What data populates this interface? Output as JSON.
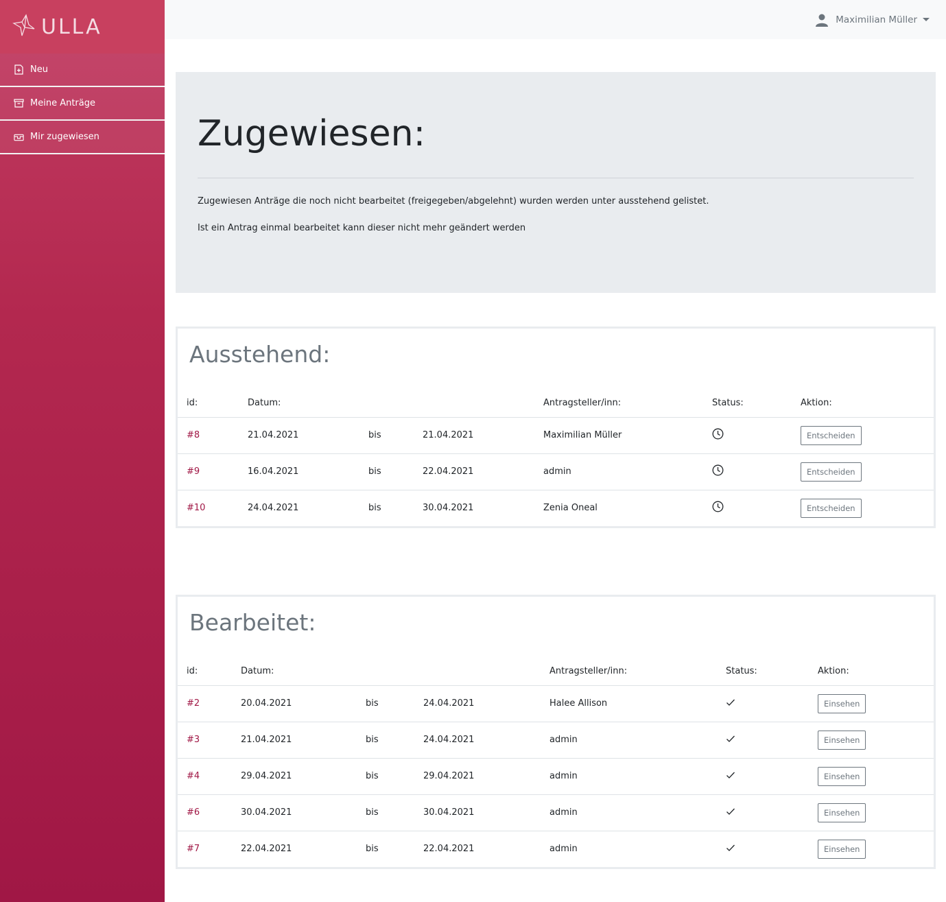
{
  "brand": {
    "name": "ULLA"
  },
  "sidebar": {
    "items": [
      {
        "label": "Neu",
        "icon": "file-plus-icon"
      },
      {
        "label": "Meine Anträge",
        "icon": "archive-icon"
      },
      {
        "label": "Mir zugewiesen",
        "icon": "inbox-icon"
      }
    ]
  },
  "header": {
    "user_name": "Maximilian Müller"
  },
  "jumbotron": {
    "title": "Zugewiesen:",
    "text1": "Zugewiesen Anträge die noch nicht bearbeitet (freigegeben/abgelehnt) wurden werden unter ausstehend gelistet.",
    "text2": "Ist ein Antrag einmal bearbeitet kann dieser nicht mehr geändert werden"
  },
  "pending": {
    "title": "Ausstehend:",
    "headers": {
      "id": "id:",
      "date": "Datum:",
      "applicant": "Antragsteller/inn:",
      "status": "Status:",
      "action": "Aktion:"
    },
    "rows": [
      {
        "id": "#8",
        "from": "21.04.2021",
        "sep": "bis",
        "to": "21.04.2021",
        "applicant": "Maximilian Müller",
        "status": "clock-icon",
        "action": "Entscheiden"
      },
      {
        "id": "#9",
        "from": "16.04.2021",
        "sep": "bis",
        "to": "22.04.2021",
        "applicant": "admin",
        "status": "clock-icon",
        "action": "Entscheiden"
      },
      {
        "id": "#10",
        "from": "24.04.2021",
        "sep": "bis",
        "to": "30.04.2021",
        "applicant": "Zenia Oneal",
        "status": "clock-icon",
        "action": "Entscheiden"
      }
    ]
  },
  "processed": {
    "title": "Bearbeitet:",
    "headers": {
      "id": "id:",
      "date": "Datum:",
      "applicant": "Antragsteller/inn:",
      "status": "Status:",
      "action": "Aktion:"
    },
    "rows": [
      {
        "id": "#2",
        "from": "20.04.2021",
        "sep": "bis",
        "to": "24.04.2021",
        "applicant": "Halee Allison",
        "status": "check-icon",
        "action": "Einsehen"
      },
      {
        "id": "#3",
        "from": "21.04.2021",
        "sep": "bis",
        "to": "24.04.2021",
        "applicant": "admin",
        "status": "check-icon",
        "action": "Einsehen"
      },
      {
        "id": "#4",
        "from": "29.04.2021",
        "sep": "bis",
        "to": "29.04.2021",
        "applicant": "admin",
        "status": "check-icon",
        "action": "Einsehen"
      },
      {
        "id": "#6",
        "from": "30.04.2021",
        "sep": "bis",
        "to": "30.04.2021",
        "applicant": "admin",
        "status": "check-icon",
        "action": "Einsehen"
      },
      {
        "id": "#7",
        "from": "22.04.2021",
        "sep": "bis",
        "to": "22.04.2021",
        "applicant": "admin",
        "status": "check-icon",
        "action": "Einsehen"
      }
    ]
  },
  "colors": {
    "accent": "#a01745",
    "sidebar_top": "#c23c62",
    "sidebar_bottom": "#a01745"
  }
}
